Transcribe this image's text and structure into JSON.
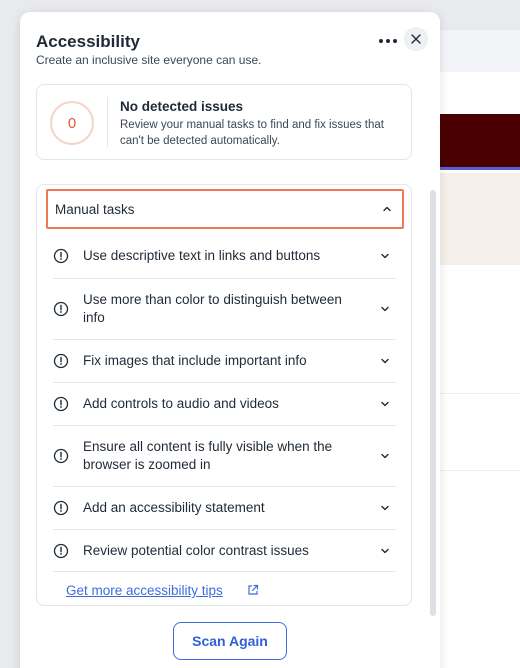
{
  "panel": {
    "title": "Accessibility",
    "subtitle": "Create an inclusive site everyone can use."
  },
  "summary": {
    "issue_count": "0",
    "title": "No detected issues",
    "description": "Review your manual tasks to find and fix issues that can't be detected automatically."
  },
  "manual_tasks": {
    "header": "Manual tasks",
    "items": [
      {
        "label": "Use descriptive text in links and buttons"
      },
      {
        "label": "Use more than color to distinguish between info"
      },
      {
        "label": "Fix images that include important info"
      },
      {
        "label": "Add controls to audio and videos"
      },
      {
        "label": "Ensure all content is fully visible when the browser is zoomed in"
      },
      {
        "label": "Add an accessibility statement"
      },
      {
        "label": "Review potential color contrast issues"
      }
    ],
    "tips_link": "Get more accessibility tips"
  },
  "actions": {
    "scan_again": "Scan Again"
  },
  "colors": {
    "accent": "#3d6ce0",
    "issue": "#e4533b",
    "highlight": "#f07855"
  },
  "icons": [
    "more-icon",
    "close-icon",
    "chevron-up-icon",
    "chevron-down-icon",
    "warning-icon",
    "external-link-icon"
  ]
}
